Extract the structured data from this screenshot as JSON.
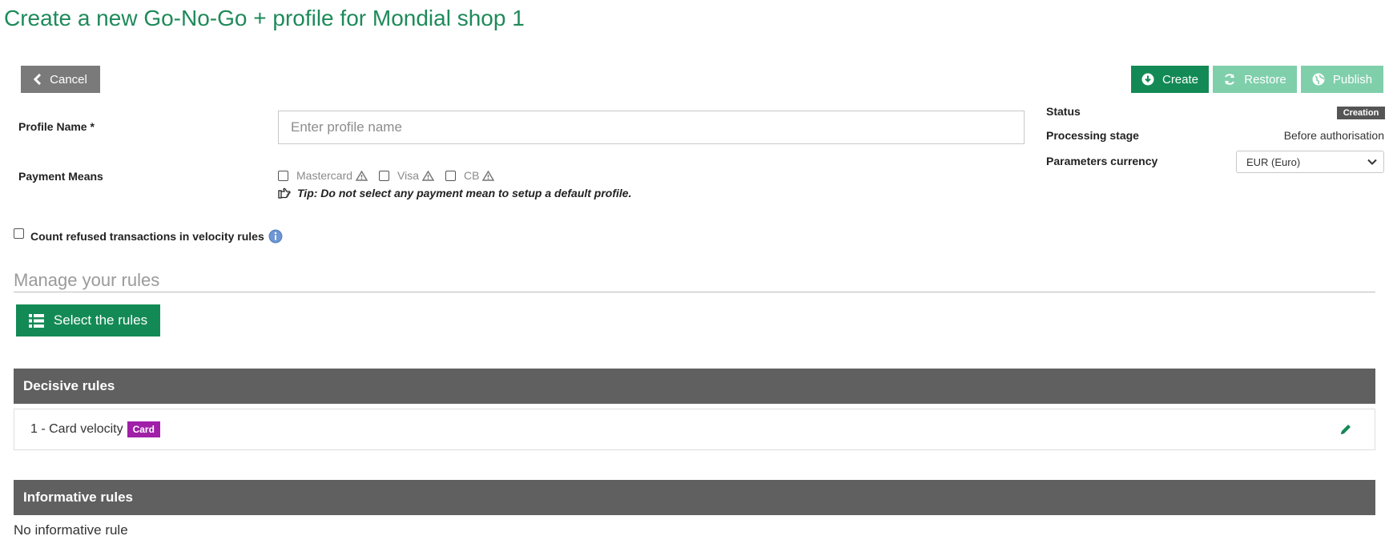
{
  "page": {
    "title": "Create a new Go-No-Go + profile for Mondial shop 1"
  },
  "toolbar": {
    "cancel_label": "Cancel",
    "create_label": "Create",
    "restore_label": "Restore",
    "publish_label": "Publish"
  },
  "form": {
    "profile_name": {
      "label": "Profile Name",
      "required_mark": "*",
      "placeholder": "Enter profile name",
      "value": ""
    },
    "payment_means": {
      "label": "Payment Means",
      "options": [
        {
          "label": "Mastercard",
          "checked": false,
          "icon": "warning-icon"
        },
        {
          "label": "Visa",
          "checked": false,
          "icon": "warning-icon"
        },
        {
          "label": "CB",
          "checked": false,
          "icon": "warning-icon"
        }
      ],
      "tip": "Tip: Do not select any payment mean to setup a default profile."
    },
    "count_refused": {
      "label": "Count refused transactions in velocity rules",
      "checked": false
    }
  },
  "meta": {
    "status_label": "Status",
    "status_value": "Creation",
    "processing_stage_label": "Processing stage",
    "processing_stage_value": "Before authorisation",
    "currency_label": "Parameters currency",
    "currency_value": "EUR (Euro)"
  },
  "rules": {
    "section_title": "Manage your rules",
    "select_button_label": "Select the rules",
    "decisive": {
      "title": "Decisive rules",
      "items": [
        {
          "label": "1 - Card velocity",
          "tag": "Card"
        }
      ]
    },
    "informative": {
      "title": "Informative rules",
      "empty_text": "No informative rule"
    }
  },
  "colors": {
    "brand_green": "#138a55",
    "title_green": "#1e8a5a",
    "disabled_green": "#7fcfab",
    "bar_gray": "#606060",
    "tag_purple": "#a020a8"
  }
}
